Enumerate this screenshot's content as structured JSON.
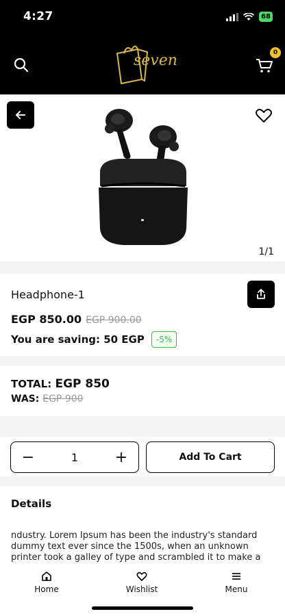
{
  "status_bar": {
    "time": "4:27",
    "battery": "68"
  },
  "header": {
    "brand": "seven",
    "cart_count": "0"
  },
  "product": {
    "image_counter": "1/1",
    "name": "Headphone-1",
    "price": "EGP 850.00",
    "old_price": "EGP 900.00",
    "saving_text": "You are saving: 50 EGP",
    "discount": "-5%"
  },
  "totals": {
    "total_label": "TOTAL:",
    "total_value": "EGP 850",
    "was_label": "WAS:",
    "was_value": "EGP 900"
  },
  "cart": {
    "quantity": "1",
    "minus": "−",
    "plus": "+",
    "add_label": "Add To Cart"
  },
  "details": {
    "title": "Details",
    "text": "ndustry. Lorem Ipsum has been the industry's standard dummy text ever since the 1500s, when an unknown printer took a galley of type and scrambled it to make a type"
  },
  "nav": {
    "home": "Home",
    "wishlist": "Wishlist",
    "menu": "Menu"
  },
  "colors": {
    "brand_gold": "#d8b84a",
    "badge": "#f2c12e",
    "discount_green": "#3cb14a"
  },
  "icons": [
    "search-icon",
    "cart-icon",
    "back-arrow-icon",
    "heart-icon",
    "share-icon",
    "home-icon",
    "menu-icon"
  ]
}
